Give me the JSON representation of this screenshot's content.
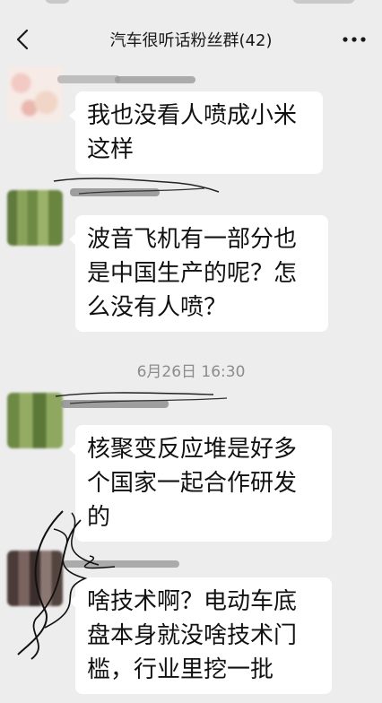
{
  "chat": {
    "title": "汽车很听话粉丝群(42)"
  },
  "icons": {
    "back": "chevron-left-icon",
    "more": "more-dots-icon"
  },
  "messages": [
    {
      "text": "我也没看人喷成小米\n这样"
    },
    {
      "text": "波音飞机有一部分也\n是中国生产的呢？怎\n么没有人喷？"
    },
    {
      "timestamp": "6月26日 16:30"
    },
    {
      "text": "核聚变反应堆是好多\n个国家一起合作研发\n的"
    },
    {
      "text": "啥技术啊？电动车底\n盘本身就没啥技术门\n槛，行业里挖一批"
    }
  ],
  "colors": {
    "background": "#ededed",
    "bubble": "#ffffff",
    "text": "#111111",
    "timestamp": "#8c8c8c"
  }
}
